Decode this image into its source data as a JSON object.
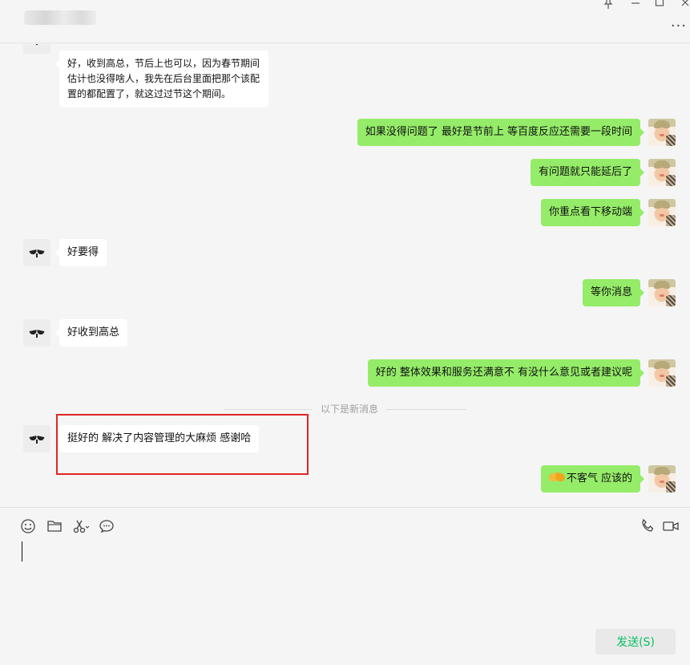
{
  "header": {
    "contact_name": "",
    "controls": [
      "pin-icon",
      "minimize-icon",
      "maximize-icon",
      "close-icon"
    ],
    "more_label": "···"
  },
  "messages": [
    {
      "side": "in",
      "text": "好，收到高总，节后上也可以，因为春节期间估计也没得啥人，我先在后台里面把那个该配置的都配置了，就这过过节这个期间。"
    },
    {
      "side": "out",
      "text": "如果没得问题了 最好是节前上 等百度反应还需要一段时间"
    },
    {
      "side": "out",
      "text": "有问题就只能延后了"
    },
    {
      "side": "out",
      "text": "你重点看下移动端"
    },
    {
      "side": "in",
      "text": "好要得"
    },
    {
      "side": "out",
      "text": "等你消息"
    },
    {
      "side": "in",
      "text": "好收到高总"
    },
    {
      "side": "out",
      "text": "好的  整体效果和服务还满意不 有没什么意见或者建议呢"
    },
    {
      "side": "in",
      "text": "挺好的 解决了内容管理的大麻烦 感谢哈"
    },
    {
      "side": "out",
      "emoji": "handshake-icon",
      "text": "不客气 应该的"
    }
  ],
  "divider": {
    "text": "以下是新消息"
  },
  "colors": {
    "outgoing_bubble": "#95ec69",
    "incoming_bubble": "#ffffff",
    "highlight": "#e22424",
    "send_text": "#07c160"
  },
  "toolbar": {
    "icons": [
      "emoji-icon",
      "folder-icon",
      "scissors-icon",
      "chat-bubble-icon",
      "phone-icon",
      "video-icon"
    ]
  },
  "composer": {
    "value": "",
    "send_label": "发送(S)"
  }
}
